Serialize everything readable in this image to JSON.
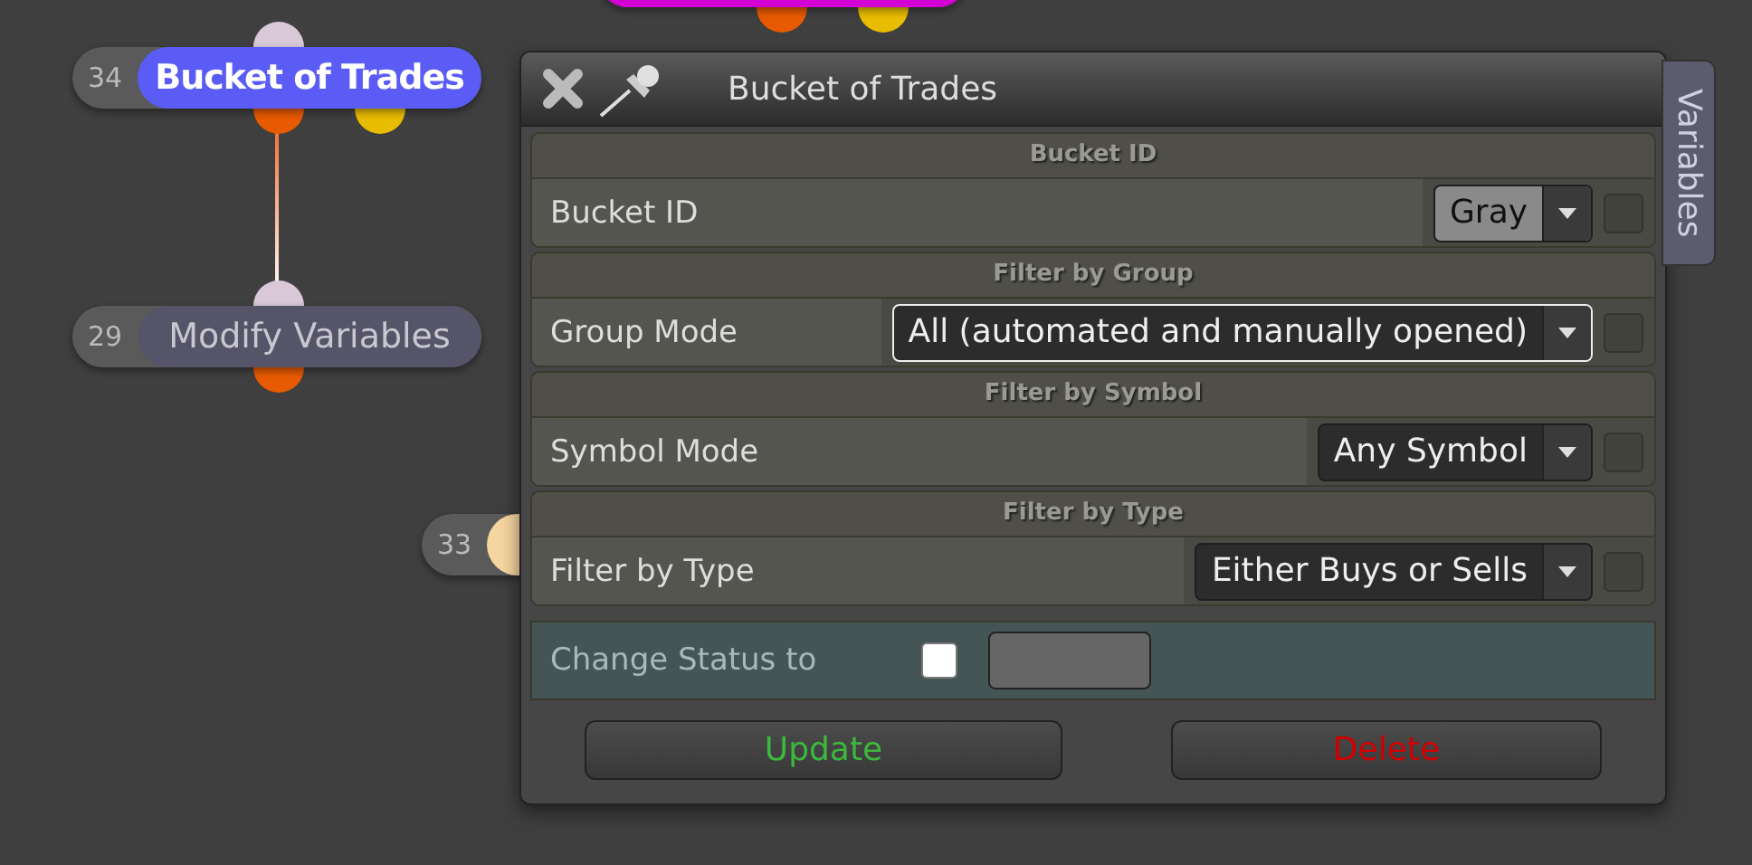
{
  "canvas": {
    "nodes": [
      {
        "color": "#d200d2",
        "outputs": [
          {
            "color": "#e85a00"
          },
          {
            "color": "#e8bc00"
          }
        ]
      },
      {
        "number": "34",
        "label": "Bucket of Trades",
        "color": "#5a5cf5",
        "selected": true,
        "inputs": [
          {
            "color": "#d8c8d8"
          }
        ],
        "outputs": [
          {
            "color": "#e85a00"
          },
          {
            "color": "#e8bc00"
          }
        ]
      },
      {
        "number": "29",
        "label": "Modify Variables",
        "color": "#565468",
        "selected": false,
        "inputs": [
          {
            "color": "#d8c8d8"
          }
        ],
        "outputs": [
          {
            "color": "#e85a00"
          }
        ]
      },
      {
        "number": "33",
        "color": "#f5d5a0"
      }
    ]
  },
  "dialog": {
    "title": "Bucket of Trades",
    "side_tab": "Variables",
    "sections": [
      {
        "heading": "Bucket ID",
        "label": "Bucket ID",
        "value": "Gray",
        "kind": "light",
        "focused": false,
        "checked": false
      },
      {
        "heading": "Filter by Group",
        "label": "Group Mode",
        "value": "All (automated and manually opened)",
        "kind": "dark",
        "focused": true,
        "checked": false
      },
      {
        "heading": "Filter by Symbol",
        "label": "Symbol Mode",
        "value": "Any Symbol",
        "kind": "dark",
        "focused": false,
        "checked": false
      },
      {
        "heading": "Filter by Type",
        "label": "Filter by Type",
        "value": "Either Buys or Sells",
        "kind": "dark",
        "focused": false,
        "checked": false
      }
    ],
    "status": {
      "label": "Change Status to",
      "checked": false
    },
    "buttons": [
      {
        "label": "Update",
        "kind": "confirm"
      },
      {
        "label": "Delete",
        "kind": "danger"
      }
    ]
  }
}
